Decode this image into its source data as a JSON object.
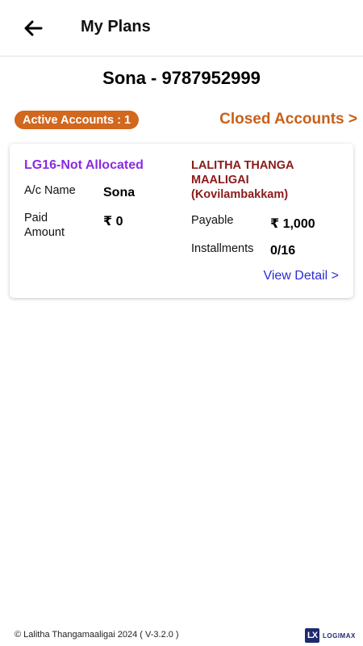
{
  "header": {
    "title": "My Plans",
    "back_icon": "arrow-left-icon"
  },
  "customer": {
    "line": "Sona - 9787952999"
  },
  "accounts": {
    "active_label": "Active Accounts : 1",
    "closed_label": "Closed Accounts >"
  },
  "plan_card": {
    "scheme_code": "LG16-Not Allocated",
    "store_name": "LALITHA THANGA MAALIGAI (Kovilambakkam)",
    "ac_name_label": "A/c Name",
    "ac_name_value": "Sona",
    "paid_label": "Paid Amount",
    "paid_value": "₹ 0",
    "payable_label": "Payable",
    "payable_value": "₹ 1,000",
    "installments_label": "Installments",
    "installments_value": "0/16",
    "view_detail": "View Detail >"
  },
  "footer": {
    "copyright": "© Lalitha Thangamaaligai 2024 ( V-3.2.0 )",
    "brand_mark": "LX",
    "brand_word": "LOGIMAX"
  },
  "colors": {
    "badge_bg": "#d2671e",
    "closed_link": "#c9601a",
    "scheme_code": "#8a2be2",
    "store_name": "#8b1a1a",
    "view_detail": "#2b2bd6"
  }
}
